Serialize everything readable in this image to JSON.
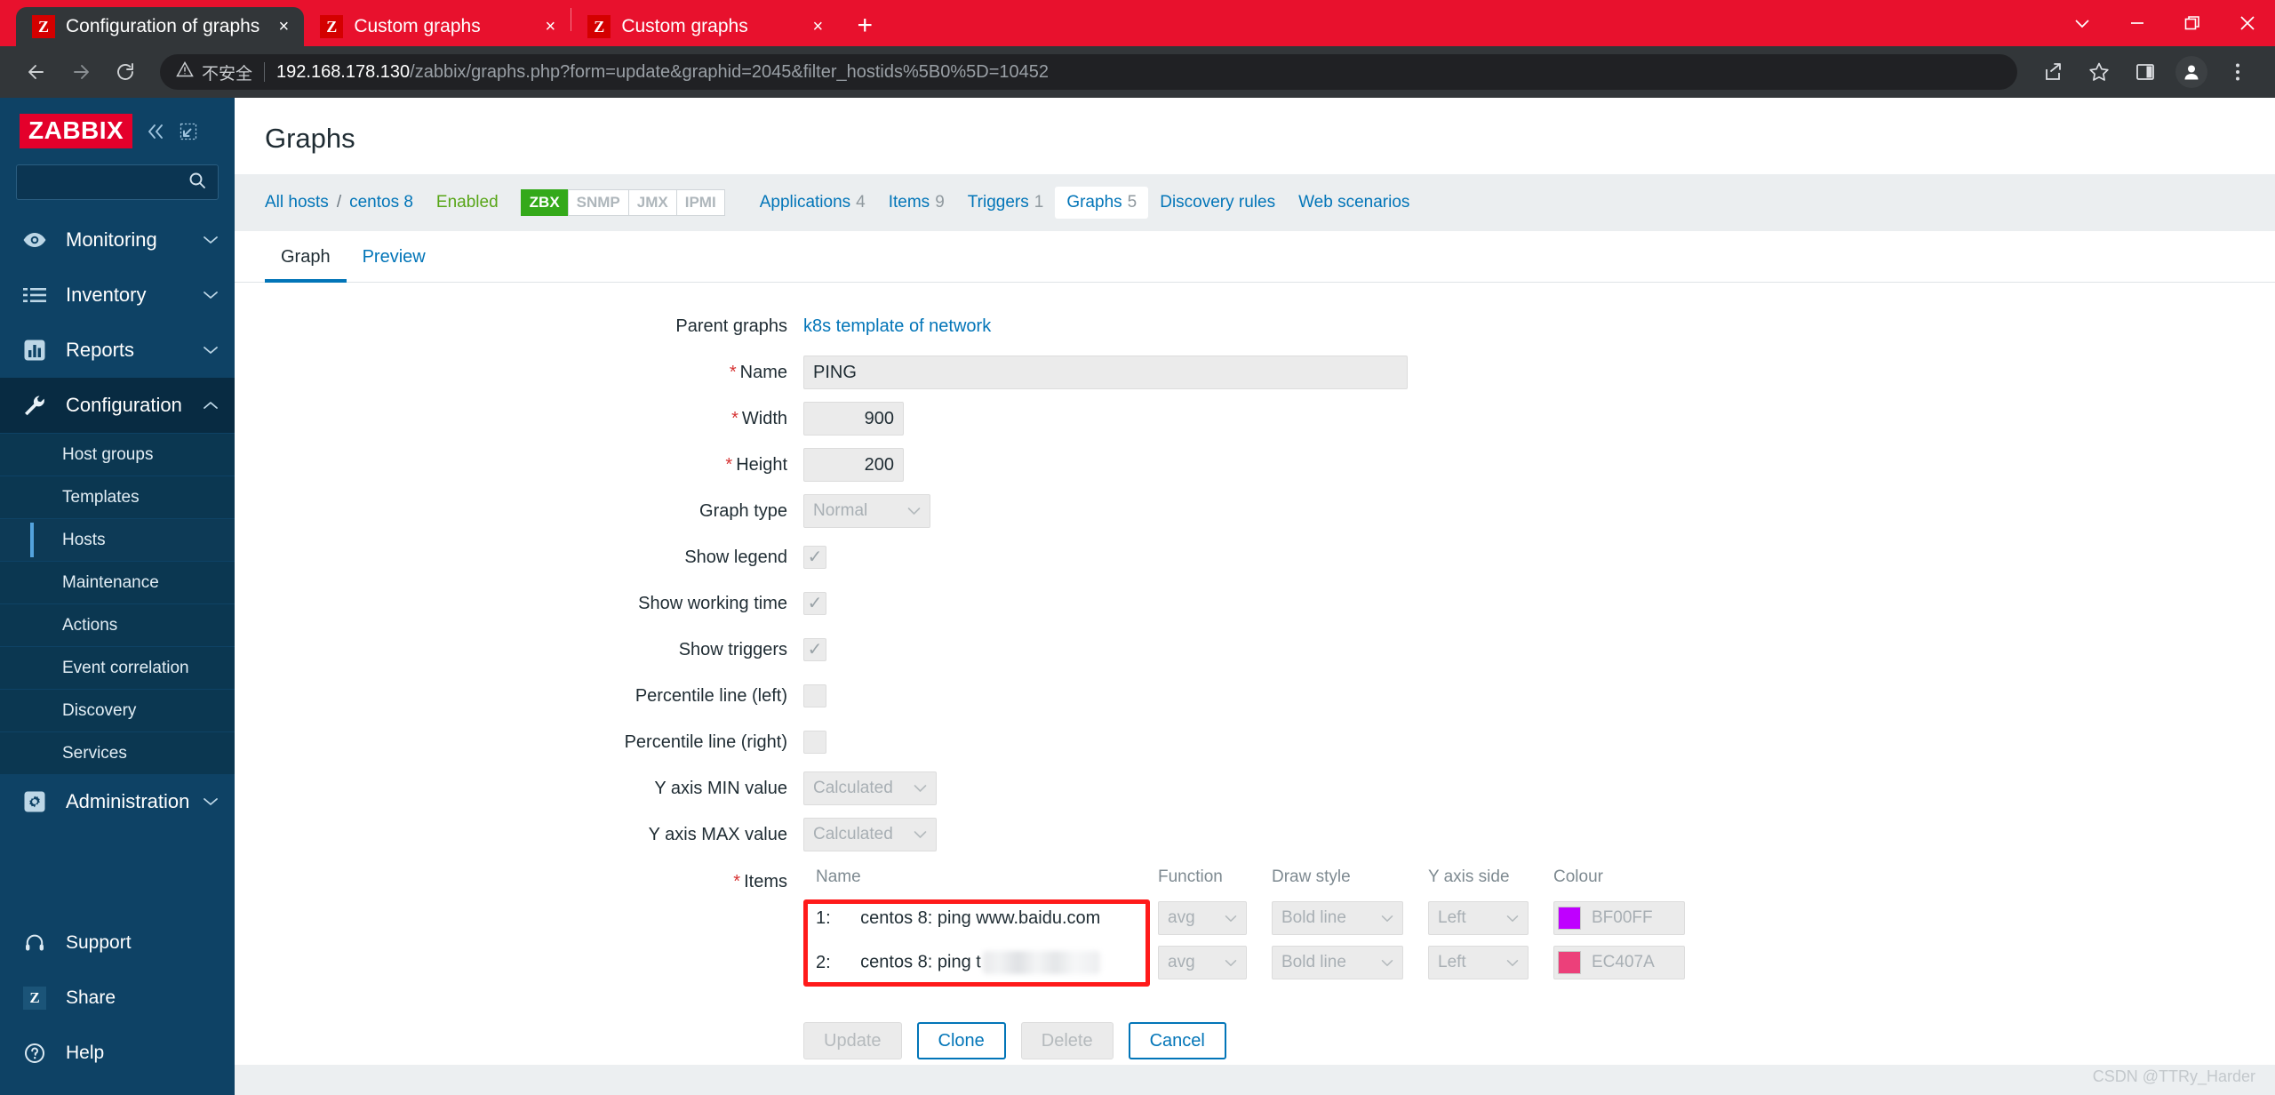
{
  "browser": {
    "tabs": [
      {
        "title": "Configuration of graphs",
        "favicon": "Z",
        "active": true,
        "close_label": "×"
      },
      {
        "title": "Custom graphs",
        "favicon": "Z",
        "active": false,
        "close_label": "×"
      },
      {
        "title": "Custom graphs",
        "favicon": "Z",
        "active": false,
        "close_label": "×"
      }
    ],
    "new_tab_label": "+",
    "window_controls": [
      "chevron-down-icon",
      "minimize-icon",
      "maximize-icon",
      "close-icon"
    ],
    "nav": {
      "back": "back-icon",
      "forward": "forward-icon",
      "reload": "reload-icon"
    },
    "omnibox": {
      "security_label": "不安全",
      "url_host": "192.168.178.130",
      "url_path": "/zabbix/graphs.php?form=update&graphid=2045&filter_hostids%5B0%5D=10452"
    },
    "toolbar_icons": [
      "share-icon",
      "star-icon",
      "side-panel-icon",
      "profile-avatar-icon",
      "more-menu-icon"
    ],
    "theme_color": "#E8112D"
  },
  "sidebar": {
    "logo": "ZABBIX",
    "collapse_icon": "double-chevron-left-icon",
    "compact_icon": "collapse-pane-icon",
    "search": {
      "value": "",
      "placeholder": ""
    },
    "items": [
      {
        "label": "Monitoring",
        "icon": "eye-icon",
        "caret": "chevron-down-icon",
        "open": false
      },
      {
        "label": "Inventory",
        "icon": "list-icon",
        "caret": "chevron-down-icon",
        "open": false
      },
      {
        "label": "Reports",
        "icon": "bar-chart-icon",
        "caret": "chevron-down-icon",
        "open": false
      },
      {
        "label": "Configuration",
        "icon": "wrench-icon",
        "caret": "chevron-up-icon",
        "open": true
      }
    ],
    "subitems": [
      {
        "label": "Host groups",
        "active": false
      },
      {
        "label": "Templates",
        "active": false
      },
      {
        "label": "Hosts",
        "active": true
      },
      {
        "label": "Maintenance",
        "active": false
      },
      {
        "label": "Actions",
        "active": false
      },
      {
        "label": "Event correlation",
        "active": false
      },
      {
        "label": "Discovery",
        "active": false
      },
      {
        "label": "Services",
        "active": false
      }
    ],
    "administration": {
      "label": "Administration",
      "icon": "gear-icon",
      "caret": "chevron-down-icon"
    },
    "footer": [
      {
        "label": "Support",
        "icon": "headset-icon"
      },
      {
        "label": "Share",
        "icon": "zabbix-z-icon"
      },
      {
        "label": "Help",
        "icon": "question-icon"
      }
    ]
  },
  "header": {
    "title": "Graphs"
  },
  "hostbar": {
    "all_hosts": "All hosts",
    "separator": "/",
    "host_name": "centos 8",
    "status": "Enabled",
    "protocols": [
      {
        "label": "ZBX",
        "on": true
      },
      {
        "label": "SNMP",
        "on": false
      },
      {
        "label": "JMX",
        "on": false
      },
      {
        "label": "IPMI",
        "on": false
      }
    ],
    "nav": [
      {
        "label": "Applications",
        "count": "4",
        "active": false
      },
      {
        "label": "Items",
        "count": "9",
        "active": false
      },
      {
        "label": "Triggers",
        "count": "1",
        "active": false
      },
      {
        "label": "Graphs",
        "count": "5",
        "active": true
      },
      {
        "label": "Discovery rules",
        "count": "",
        "active": false
      },
      {
        "label": "Web scenarios",
        "count": "",
        "active": false
      }
    ]
  },
  "form_tabs": [
    {
      "label": "Graph",
      "active": true
    },
    {
      "label": "Preview",
      "active": false
    }
  ],
  "form": {
    "parent_graphs": {
      "label": "Parent graphs",
      "value": "k8s template of network"
    },
    "name": {
      "label": "Name",
      "required": true,
      "value": "PING",
      "placeholder": ""
    },
    "width": {
      "label": "Width",
      "required": true,
      "value": "900"
    },
    "height": {
      "label": "Height",
      "required": true,
      "value": "200"
    },
    "graph_type": {
      "label": "Graph type",
      "value": "Normal"
    },
    "show_legend": {
      "label": "Show legend",
      "checked": true,
      "mark": "✓"
    },
    "show_working_time": {
      "label": "Show working time",
      "checked": true,
      "mark": "✓"
    },
    "show_triggers": {
      "label": "Show triggers",
      "checked": true,
      "mark": "✓"
    },
    "percentile_left": {
      "label": "Percentile line (left)",
      "checked": false,
      "mark": ""
    },
    "percentile_right": {
      "label": "Percentile line (right)",
      "checked": false,
      "mark": ""
    },
    "y_axis_min": {
      "label": "Y axis MIN value",
      "value": "Calculated"
    },
    "y_axis_max": {
      "label": "Y axis MAX value",
      "value": "Calculated"
    },
    "items_label": "Items",
    "items_required": true
  },
  "items_table": {
    "columns": [
      "Name",
      "Function",
      "Draw style",
      "Y axis side",
      "Colour"
    ],
    "rows": [
      {
        "num": "1:",
        "name": "centos 8: ping www.baidu.com",
        "redacted": false,
        "function": "avg",
        "draw_style": "Bold line",
        "y_axis_side": "Left",
        "colour_hex": "BF00FF",
        "colour_value": "#BF00FF"
      },
      {
        "num": "2:",
        "name": "centos 8: ping t",
        "redacted": true,
        "function": "avg",
        "draw_style": "Bold line",
        "y_axis_side": "Left",
        "colour_hex": "EC407A",
        "colour_value": "#EC407A"
      }
    ],
    "highlight_colour": "#FF1A1A"
  },
  "buttons": [
    {
      "label": "Update",
      "style": "disabled"
    },
    {
      "label": "Clone",
      "style": "outline"
    },
    {
      "label": "Delete",
      "style": "disabled"
    },
    {
      "label": "Cancel",
      "style": "outline"
    }
  ],
  "watermark": "CSDN @TTRy_Harder"
}
